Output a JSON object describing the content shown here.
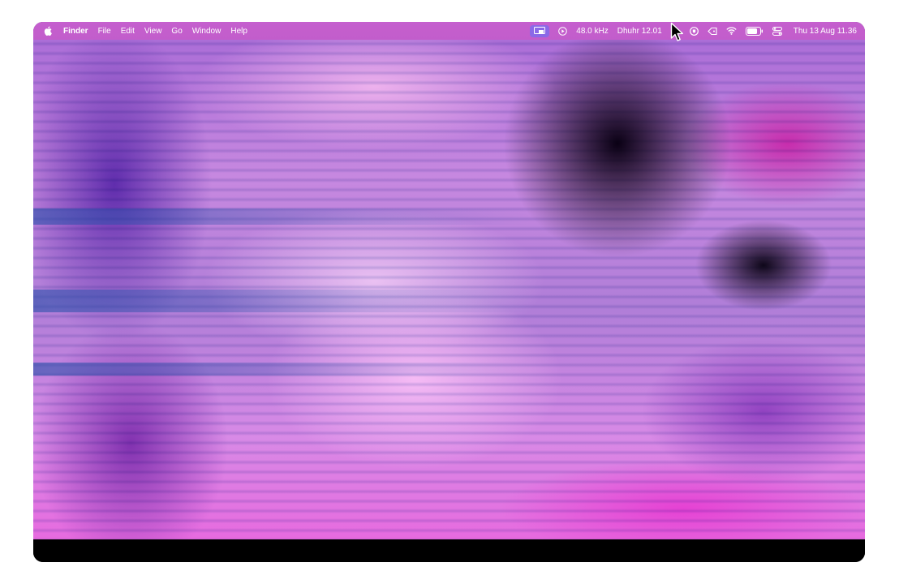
{
  "menubar": {
    "apple_icon": "apple-logo-icon",
    "app_name": "Finder",
    "menus": [
      "File",
      "Edit",
      "View",
      "Go",
      "Window",
      "Help"
    ],
    "status": {
      "screen_icon": "screen-mirroring-icon",
      "play_icon": "play-circle-icon",
      "sample_rate": "48.0 kHz",
      "prayer_time": "Dhuhr 12.01",
      "vpn_icon": "vpn-shield-icon",
      "tag_icon": "tag-icon",
      "wifi_icon": "wifi-icon",
      "battery_icon": "battery-icon",
      "battery_level": "80",
      "control_center_icon": "control-center-icon",
      "datetime": "Thu 13 Aug  11.36"
    },
    "background": "#c25dcb"
  },
  "desktop": {
    "wallpaper": "abstract-blurred-purple-pink",
    "cursor_icon": "mouse-pointer-icon"
  }
}
